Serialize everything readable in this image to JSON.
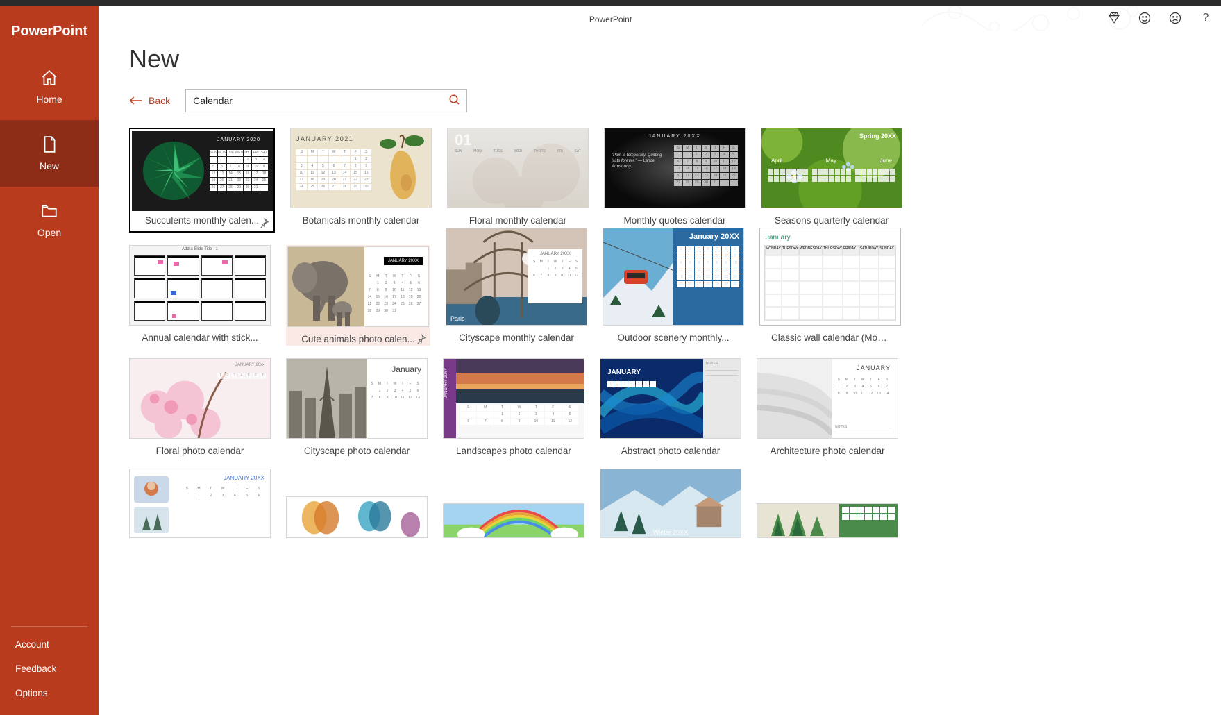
{
  "app_title": "PowerPoint",
  "sidebar": {
    "brand": "PowerPoint",
    "items": [
      {
        "label": "Home"
      },
      {
        "label": "New"
      },
      {
        "label": "Open"
      }
    ],
    "bottom": [
      {
        "label": "Account"
      },
      {
        "label": "Feedback"
      },
      {
        "label": "Options"
      }
    ]
  },
  "heading": "New",
  "back_label": "Back",
  "search": {
    "value": "Calendar"
  },
  "templates": [
    [
      {
        "label": "Succulents monthly calen...",
        "pinned": true,
        "selected": true,
        "thumb_text": "JANUARY 2020"
      },
      {
        "label": "Botanicals monthly calendar",
        "thumb_text": "JANUARY 2021"
      },
      {
        "label": "Floral monthly calendar",
        "thumb_text": "01"
      },
      {
        "label": "Monthly quotes calendar",
        "thumb_text": "JANUARY 20XX",
        "quote": "\"Pain is temporary. Quitting lasts forever.\" — Lance Armstrong"
      },
      {
        "label": "Seasons quarterly calendar",
        "thumb_text": "Spring 20XX",
        "months": [
          "April",
          "May",
          "June"
        ]
      }
    ],
    [
      {
        "label": "Annual calendar with stick...",
        "thumb_text": "Add a Slide Title - 1"
      },
      {
        "label": "Cute animals photo calen...",
        "pinned": true,
        "hovered": true,
        "thumb_text": "JANUARY 20XX"
      },
      {
        "label": "Cityscape monthly calendar",
        "thumb_text": "JANUARY 20XX",
        "city": "Paris"
      },
      {
        "label": "Outdoor scenery monthly...",
        "thumb_text": "January 20XX"
      },
      {
        "label": "Classic wall calendar (Mon...",
        "thumb_text": "January"
      }
    ],
    [
      {
        "label": "Floral photo calendar",
        "thumb_text": "JANUARY 20xx"
      },
      {
        "label": "Cityscape photo calendar",
        "thumb_text": "January"
      },
      {
        "label": "Landscapes photo calendar",
        "thumb_text": "JANUARY 20YY"
      },
      {
        "label": "Abstract photo calendar",
        "thumb_text": "JANUARY"
      },
      {
        "label": "Architecture photo calendar",
        "thumb_text": "JANUARY"
      }
    ],
    [
      {
        "label": "",
        "thumb_text": "JANUARY 20XX"
      },
      {
        "label": ""
      },
      {
        "label": ""
      },
      {
        "label": "",
        "season": "Winter 20XX"
      },
      {
        "label": ""
      }
    ]
  ]
}
